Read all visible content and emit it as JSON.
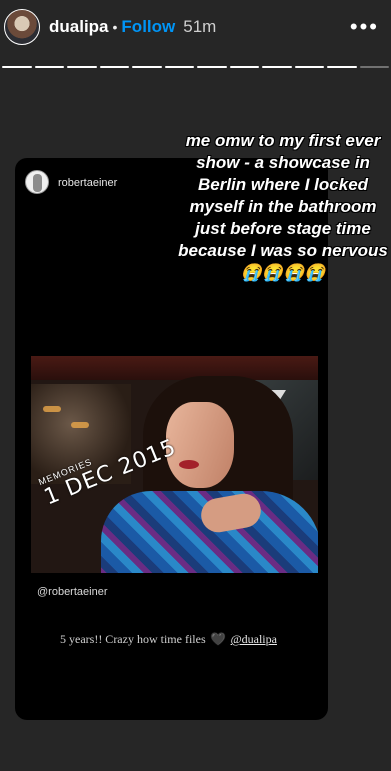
{
  "header": {
    "username": "dualipa",
    "separator": "•",
    "follow_label": "Follow",
    "time_ago": "51m",
    "more_label": "•••"
  },
  "progress": {
    "segments_total": 12,
    "segments_viewed": 11
  },
  "overlay_text": "me omw to my first ever show - a showcase in Berlin where I locked myself in the bathroom just before stage time because I was so nervous 😭😭😭😭",
  "repost": {
    "username": "robertaeiner",
    "photo_stamp_label": "MEMORIES",
    "photo_stamp_date": "1 DEC 2015",
    "tag": "@robertaeiner",
    "caption_text": "5 years!! Crazy how time files",
    "caption_heart": "🖤",
    "caption_mention": "@dualipa"
  },
  "colors": {
    "background": "#262626",
    "follow": "#0095f6",
    "card": "#000000"
  }
}
